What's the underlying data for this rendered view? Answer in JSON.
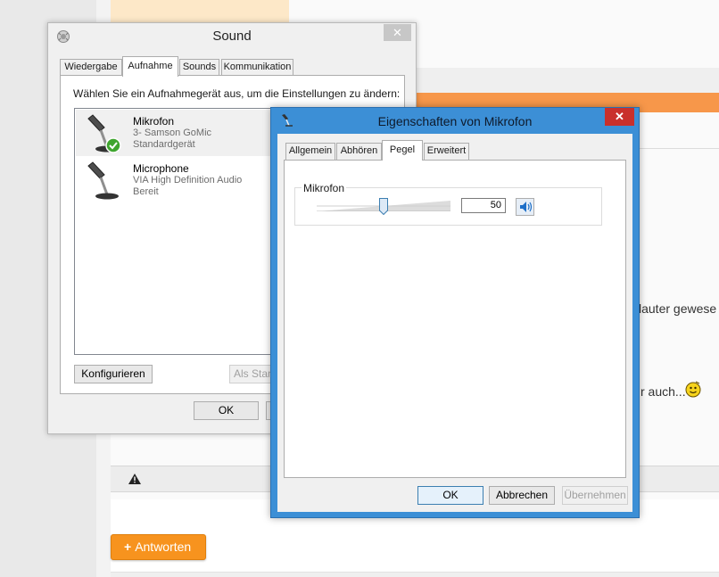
{
  "background": {
    "text_snippet_1": "lauter gewese",
    "text_snippet_2": "r auch...",
    "reply_button": {
      "plus": "+",
      "label": "Antworten"
    },
    "accent_color": "#f7974a"
  },
  "sound_window": {
    "title": "Sound",
    "close": "✕",
    "tabs": [
      "Wiedergabe",
      "Aufnahme",
      "Sounds",
      "Kommunikation"
    ],
    "active_tab": "Aufnahme",
    "instruction": "Wählen Sie ein Aufnahmegerät aus, um die Einstellungen zu ändern:",
    "devices": [
      {
        "name": "Mikrofon",
        "line1": "3- Samson GoMic",
        "line2": "Standardgerät",
        "icon": "microphone-default-icon"
      },
      {
        "name": "Microphone",
        "line1": "VIA High Definition Audio",
        "line2": "Bereit",
        "icon": "microphone-icon"
      }
    ],
    "configure_button": "Konfigurieren",
    "set_default_button": "Als Stand",
    "ok_button": "OK"
  },
  "properties_window": {
    "title": "Eigenschaften von Mikrofon",
    "close": "✕",
    "tabs": [
      "Allgemein",
      "Abhören",
      "Pegel",
      "Erweitert"
    ],
    "active_tab": "Pegel",
    "group_label": "Mikrofon",
    "level_value": "50",
    "level_fraction": 0.5,
    "ok_button": "OK",
    "cancel_button": "Abbrechen",
    "apply_button": "Übernehmen"
  }
}
